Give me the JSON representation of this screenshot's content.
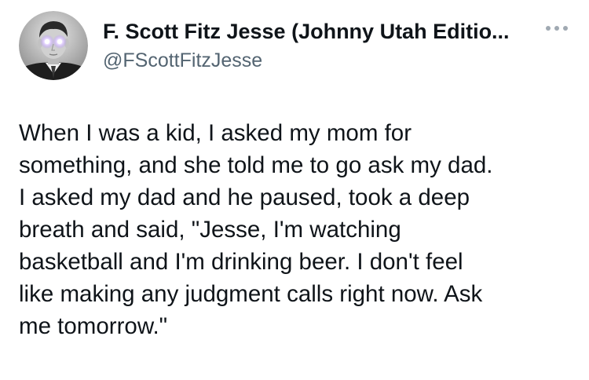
{
  "tweet": {
    "author": {
      "display_name": "F. Scott Fitz Jesse (Johnny Utah Editio...",
      "handle": "@FScottFitzJesse",
      "avatar_icon": "profile-photo"
    },
    "more_icon": "more-horizontal-icon",
    "text": "When I was a kid, I asked my mom for\nsomething, and she told me to go ask my dad.\nI asked my dad and he paused, took a deep\nbreath and said, \"Jesse, I'm watching\nbasketball and I'm drinking beer. I don't feel\nlike making any judgment calls right now. Ask\nme tomorrow.\""
  },
  "colors": {
    "text": "#0f1419",
    "secondary_text": "#536471",
    "more_icon": "#a0a9b2",
    "background": "#ffffff"
  }
}
